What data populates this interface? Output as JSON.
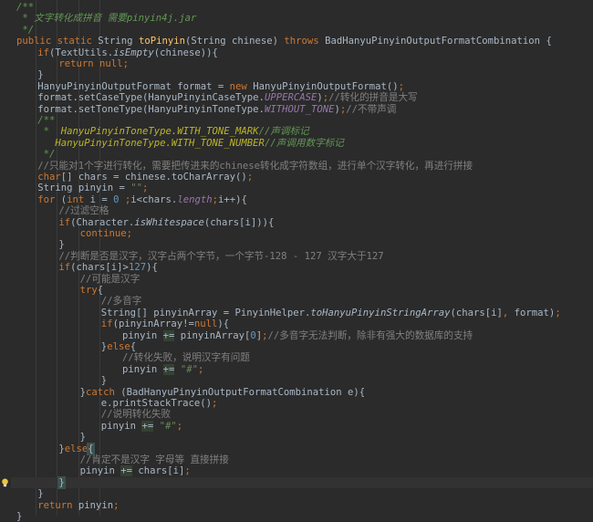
{
  "editor": {
    "language": "java",
    "colors": {
      "background": "#2b2b2b",
      "keyword": "#cc7832",
      "doc_comment": "#629755",
      "line_comment": "#808080",
      "method_decl": "#ffc66d",
      "string": "#6a8759",
      "number": "#6897bb",
      "constant": "#9876aa",
      "identifier": "#a9b7c6"
    },
    "current_line_index": 42,
    "bulb_line_index": 42,
    "lines": [
      {
        "indent": 0,
        "tokens": [
          {
            "t": "/**",
            "c": "cm"
          }
        ]
      },
      {
        "indent": 0,
        "tokens": [
          {
            "t": " * 文字转化成拼音 需要pinyin4j.jar",
            "c": "cm"
          }
        ]
      },
      {
        "indent": 0,
        "tokens": [
          {
            "t": " */",
            "c": "cm"
          }
        ]
      },
      {
        "indent": 0,
        "tokens": [
          {
            "t": "public static ",
            "c": "kw"
          },
          {
            "t": "String ",
            "c": "id"
          },
          {
            "t": "toPinyin",
            "c": "fn"
          },
          {
            "t": "(String chinese) ",
            "c": "id"
          },
          {
            "t": "throws ",
            "c": "kw"
          },
          {
            "t": "BadHanyuPinyinOutputFormatCombination {",
            "c": "id"
          }
        ]
      },
      {
        "indent": 1,
        "tokens": [
          {
            "t": "if",
            "c": "kw"
          },
          {
            "t": "(TextUtils.",
            "c": "id"
          },
          {
            "t": "isEmpty",
            "c": "it"
          },
          {
            "t": "(chinese)){",
            "c": "id"
          }
        ]
      },
      {
        "indent": 2,
        "tokens": [
          {
            "t": "return null",
            "c": "kw"
          },
          {
            "t": ";",
            "c": "kw"
          }
        ]
      },
      {
        "indent": 1,
        "tokens": [
          {
            "t": "}",
            "c": "id"
          }
        ]
      },
      {
        "indent": 1,
        "tokens": [
          {
            "t": "HanyuPinyinOutputFormat format = ",
            "c": "id"
          },
          {
            "t": "new ",
            "c": "kw"
          },
          {
            "t": "HanyuPinyinOutputFormat()",
            "c": "id"
          },
          {
            "t": ";",
            "c": "kw"
          }
        ]
      },
      {
        "indent": 1,
        "tokens": [
          {
            "t": "format.setCaseType(HanyuPinyinCaseType.",
            "c": "id"
          },
          {
            "t": "UPPERCASE",
            "c": "const"
          },
          {
            "t": ")",
            "c": "id"
          },
          {
            "t": ";",
            "c": "kw"
          },
          {
            "t": "//转化的拼音是大写",
            "c": "lc"
          }
        ]
      },
      {
        "indent": 1,
        "tokens": [
          {
            "t": "format.setToneType(HanyuPinyinToneType.",
            "c": "id"
          },
          {
            "t": "WITHOUT_TONE",
            "c": "const"
          },
          {
            "t": ")",
            "c": "id"
          },
          {
            "t": ";",
            "c": "kw"
          },
          {
            "t": "//不带声调",
            "c": "lc"
          }
        ]
      },
      {
        "indent": 1,
        "tokens": [
          {
            "t": "/**",
            "c": "cm"
          }
        ]
      },
      {
        "indent": 1,
        "tokens": [
          {
            "t": " *  ",
            "c": "cm"
          },
          {
            "t": "HanyuPinyinToneType.WITH_TONE_MARK",
            "c": "tag"
          },
          {
            "t": "//声调标记",
            "c": "cm"
          }
        ]
      },
      {
        "indent": 1,
        "tokens": [
          {
            "t": "   ",
            "c": "cm"
          },
          {
            "t": "HanyuPinyinToneType.WITH_TONE_NUMBER",
            "c": "tag"
          },
          {
            "t": "//声调用数字标记",
            "c": "cm"
          }
        ]
      },
      {
        "indent": 1,
        "tokens": [
          {
            "t": " */",
            "c": "cm"
          }
        ]
      },
      {
        "indent": 1,
        "tokens": [
          {
            "t": "//只能对1个字进行转化，需要把传进来的chinese转化成字符数组，进行单个汉字转化，再进行拼接",
            "c": "lc"
          }
        ]
      },
      {
        "indent": 1,
        "tokens": [
          {
            "t": "char",
            "c": "kw"
          },
          {
            "t": "[] chars = chinese.toCharArray()",
            "c": "id"
          },
          {
            "t": ";",
            "c": "kw"
          }
        ]
      },
      {
        "indent": 1,
        "tokens": [
          {
            "t": "String pinyin = ",
            "c": "id"
          },
          {
            "t": "\"\"",
            "c": "str"
          },
          {
            "t": ";",
            "c": "kw"
          }
        ]
      },
      {
        "indent": 1,
        "tokens": [
          {
            "t": "for ",
            "c": "kw"
          },
          {
            "t": "(",
            "c": "id"
          },
          {
            "t": "int ",
            "c": "kw"
          },
          {
            "t": "i = ",
            "c": "id"
          },
          {
            "t": "0 ",
            "c": "num"
          },
          {
            "t": ";",
            "c": "kw"
          },
          {
            "t": "i<chars.",
            "c": "id"
          },
          {
            "t": "length",
            "c": "const"
          },
          {
            "t": ";",
            "c": "kw"
          },
          {
            "t": "i++){",
            "c": "id"
          }
        ]
      },
      {
        "indent": 2,
        "tokens": [
          {
            "t": "//过滤空格",
            "c": "lc"
          }
        ]
      },
      {
        "indent": 2,
        "tokens": [
          {
            "t": "if",
            "c": "kw"
          },
          {
            "t": "(Character.",
            "c": "id"
          },
          {
            "t": "isWhitespace",
            "c": "it"
          },
          {
            "t": "(chars[i])){",
            "c": "id"
          }
        ]
      },
      {
        "indent": 3,
        "tokens": [
          {
            "t": "continue;",
            "c": "kw"
          }
        ]
      },
      {
        "indent": 2,
        "tokens": [
          {
            "t": "}",
            "c": "id"
          }
        ]
      },
      {
        "indent": 2,
        "tokens": [
          {
            "t": "//判断是否是汉字，汉字占两个字节，一个字节-128 - 127 汉字大于127",
            "c": "lc"
          }
        ]
      },
      {
        "indent": 2,
        "tokens": [
          {
            "t": "if",
            "c": "kw"
          },
          {
            "t": "(chars[i]>",
            "c": "id"
          },
          {
            "t": "127",
            "c": "num"
          },
          {
            "t": "){",
            "c": "id"
          }
        ]
      },
      {
        "indent": 3,
        "tokens": [
          {
            "t": "//可能是汉字",
            "c": "lc"
          }
        ]
      },
      {
        "indent": 3,
        "tokens": [
          {
            "t": "try",
            "c": "kw"
          },
          {
            "t": "{",
            "c": "id"
          }
        ]
      },
      {
        "indent": 4,
        "tokens": [
          {
            "t": "//多音字",
            "c": "lc"
          }
        ]
      },
      {
        "indent": 4,
        "tokens": [
          {
            "t": "String[] pinyinArray = PinyinHelper.",
            "c": "id"
          },
          {
            "t": "toHanyuPinyinStringArray",
            "c": "it"
          },
          {
            "t": "(chars[i]",
            "c": "id"
          },
          {
            "t": ", ",
            "c": "kw"
          },
          {
            "t": "format)",
            "c": "id"
          },
          {
            "t": ";",
            "c": "kw"
          }
        ]
      },
      {
        "indent": 4,
        "tokens": [
          {
            "t": "if",
            "c": "kw"
          },
          {
            "t": "(pinyinArray!=",
            "c": "id"
          },
          {
            "t": "null",
            "c": "kw"
          },
          {
            "t": "){",
            "c": "id"
          }
        ]
      },
      {
        "indent": 5,
        "tokens": [
          {
            "t": "pinyin ",
            "c": "id"
          },
          {
            "t": "+=",
            "c": "op"
          },
          {
            "t": " pinyinArray[",
            "c": "id"
          },
          {
            "t": "0",
            "c": "num"
          },
          {
            "t": "]",
            "c": "id"
          },
          {
            "t": ";",
            "c": "kw"
          },
          {
            "t": "//多音字无法判断，除非有强大的数据库的支持",
            "c": "lc"
          }
        ]
      },
      {
        "indent": 4,
        "tokens": [
          {
            "t": "}",
            "c": "id"
          },
          {
            "t": "else",
            "c": "kw"
          },
          {
            "t": "{",
            "c": "id"
          }
        ]
      },
      {
        "indent": 5,
        "tokens": [
          {
            "t": "//转化失败，说明汉字有问题",
            "c": "lc"
          }
        ]
      },
      {
        "indent": 5,
        "tokens": [
          {
            "t": "pinyin ",
            "c": "id"
          },
          {
            "t": "+=",
            "c": "op"
          },
          {
            "t": " ",
            "c": "id"
          },
          {
            "t": "\"#\"",
            "c": "str"
          },
          {
            "t": ";",
            "c": "kw"
          }
        ]
      },
      {
        "indent": 4,
        "tokens": [
          {
            "t": "}",
            "c": "id"
          }
        ]
      },
      {
        "indent": 3,
        "tokens": [
          {
            "t": "}",
            "c": "id"
          },
          {
            "t": "catch ",
            "c": "kw"
          },
          {
            "t": "(BadHanyuPinyinOutputFormatCombination e){",
            "c": "id"
          }
        ]
      },
      {
        "indent": 4,
        "tokens": [
          {
            "t": "e.printStackTrace()",
            "c": "id"
          },
          {
            "t": ";",
            "c": "kw"
          }
        ]
      },
      {
        "indent": 4,
        "tokens": [
          {
            "t": "//说明转化失败",
            "c": "lc"
          }
        ]
      },
      {
        "indent": 4,
        "tokens": [
          {
            "t": "pinyin ",
            "c": "id"
          },
          {
            "t": "+=",
            "c": "op"
          },
          {
            "t": " ",
            "c": "id"
          },
          {
            "t": "\"#\"",
            "c": "str"
          },
          {
            "t": ";",
            "c": "kw"
          }
        ]
      },
      {
        "indent": 3,
        "tokens": [
          {
            "t": "}",
            "c": "id"
          }
        ]
      },
      {
        "indent": 2,
        "tokens": [
          {
            "t": "}",
            "c": "id"
          },
          {
            "t": "else",
            "c": "kw"
          },
          {
            "t": "{",
            "c": "br"
          }
        ]
      },
      {
        "indent": 3,
        "tokens": [
          {
            "t": "//肯定不是汉字 字母等 直接拼接",
            "c": "lc"
          }
        ]
      },
      {
        "indent": 3,
        "tokens": [
          {
            "t": "pinyin ",
            "c": "id"
          },
          {
            "t": "+=",
            "c": "op"
          },
          {
            "t": " chars[i]",
            "c": "id"
          },
          {
            "t": ";",
            "c": "kw"
          }
        ]
      },
      {
        "indent": 2,
        "tokens": [
          {
            "t": "}",
            "c": "br"
          }
        ]
      },
      {
        "indent": 1,
        "tokens": [
          {
            "t": "}",
            "c": "id"
          }
        ]
      },
      {
        "indent": 1,
        "tokens": [
          {
            "t": "return ",
            "c": "kw"
          },
          {
            "t": "pinyin",
            "c": "id"
          },
          {
            "t": ";",
            "c": "kw"
          }
        ]
      },
      {
        "indent": 0,
        "tokens": [
          {
            "t": "}",
            "c": "id"
          }
        ]
      }
    ]
  },
  "icons": {
    "bulb": "lightbulb-icon"
  }
}
